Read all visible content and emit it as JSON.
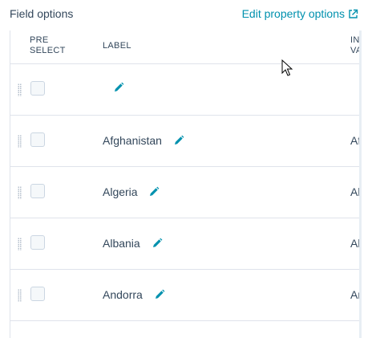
{
  "header": {
    "title": "Field options",
    "edit_link": "Edit property options"
  },
  "table": {
    "columns": {
      "preselect_line1": "PRE",
      "preselect_line2": "SELECT",
      "label": "LABEL",
      "value_line1": "INT",
      "value_line2": "VA"
    },
    "rows": [
      {
        "label": "",
        "value": ""
      },
      {
        "label": "Afghanistan",
        "value": "Af"
      },
      {
        "label": "Algeria",
        "value": "Al"
      },
      {
        "label": "Albania",
        "value": "Al"
      },
      {
        "label": "Andorra",
        "value": "An"
      }
    ]
  },
  "colors": {
    "accent": "#0091ae",
    "text": "#33475b",
    "border": "#dfe3eb"
  },
  "icons": [
    "external-link-icon",
    "pencil-icon",
    "drag-handle-icon",
    "mouse-cursor-icon"
  ]
}
